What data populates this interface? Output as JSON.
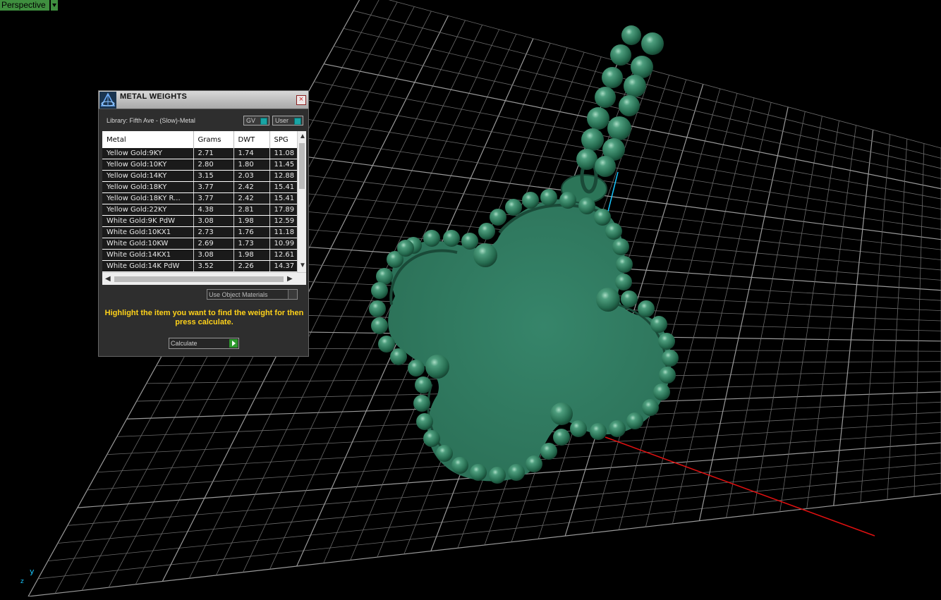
{
  "viewport": {
    "view_name": "Perspective",
    "axis_y": "y",
    "axis_z": "z"
  },
  "panel": {
    "title": "METAL WEIGHTS",
    "close_glyph": "×",
    "library_label": "Library: Fifth Ave - (Slow)-Metal",
    "toggle_gv": "GV",
    "toggle_user": "User",
    "columns": [
      "Metal",
      "Grams",
      "DWT",
      "SPG"
    ],
    "rows": [
      [
        "Yellow Gold:9KY",
        "2.71",
        "1.74",
        "11.08"
      ],
      [
        "Yellow Gold:10KY",
        "2.80",
        "1.80",
        "11.45"
      ],
      [
        "Yellow Gold:14KY",
        "3.15",
        "2.03",
        "12.88"
      ],
      [
        "Yellow Gold:18KY",
        "3.77",
        "2.42",
        "15.41"
      ],
      [
        "Yellow Gold:18KY R...",
        "3.77",
        "2.42",
        "15.41"
      ],
      [
        "Yellow Gold:22KY",
        "4.38",
        "2.81",
        "17.89"
      ],
      [
        "White Gold:9K PdW",
        "3.08",
        "1.98",
        "12.59"
      ],
      [
        "White Gold:10KX1",
        "2.73",
        "1.76",
        "11.18"
      ],
      [
        "White Gold:10KW",
        "2.69",
        "1.73",
        "10.99"
      ],
      [
        "White Gold:14KX1",
        "3.08",
        "1.98",
        "12.61"
      ],
      [
        "White Gold:14K PdW",
        "3.52",
        "2.26",
        "14.37"
      ]
    ],
    "material_select": "Use Object Materials",
    "instruction": "Highlight the item you want to find the weight for then press calculate.",
    "calculate_label": "Calculate"
  },
  "colors": {
    "model": "#2f7a5e",
    "grid": "#8a8a8a",
    "axis_x": "#e01010",
    "axis_y": "#19c8ff",
    "accent_yellow": "#ffd21a"
  }
}
